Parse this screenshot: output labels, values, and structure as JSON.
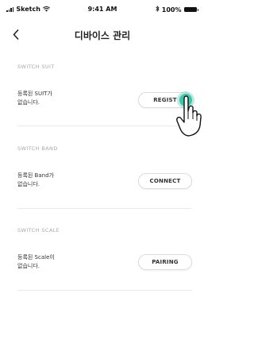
{
  "status_bar": {
    "carrier": "Sketch",
    "time": "9:41 AM",
    "battery": "100%"
  },
  "nav": {
    "title": "디바이스 관리",
    "back_icon": "chevron-left-icon"
  },
  "sections": [
    {
      "header": "SWITCH SUIT",
      "description": "등록된 SUIT가\n없습니다.",
      "button_label": "REGIST"
    },
    {
      "header": "SWITCH BAND",
      "description": "등록된 Band가\n없습니다.",
      "button_label": "CONNECT"
    },
    {
      "header": "SWITCH SCALE",
      "description": "등록된 Scale이\n없습니다.",
      "button_label": "PAIRING"
    }
  ],
  "colors": {
    "tap_indicator": "#3ec8a8",
    "section_header": "#a9a9a9",
    "divider": "#ececec"
  }
}
